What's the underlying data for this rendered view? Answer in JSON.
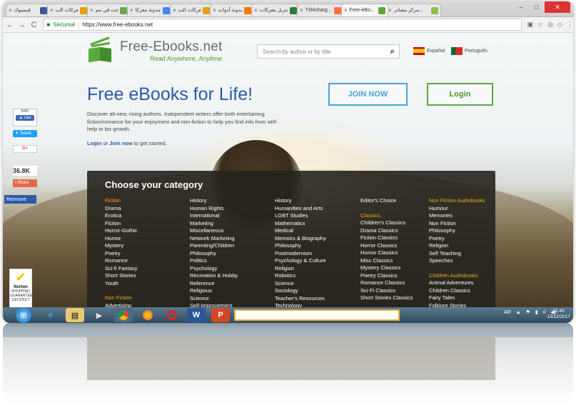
{
  "browser": {
    "tabs": [
      {
        "label": "فيسبوك",
        "color": "#3b5998"
      },
      {
        "label": "معركات الب...",
        "color": "#e5a00d"
      },
      {
        "label": "بحث في مم...",
        "color": "#6aa84f"
      },
      {
        "label": "مدونة معركا...",
        "color": "#4285f4"
      },
      {
        "label": "معركات الب...",
        "color": "#e5a00d"
      },
      {
        "label": "مدونة أدوات...",
        "color": "#f57c00"
      },
      {
        "label": "تنزيل معركات...",
        "color": "#2e7d32"
      },
      {
        "label": "Télécharg...",
        "color": "#ff7043"
      },
      {
        "label": "Free-eBo...",
        "color": "#5aa838"
      },
      {
        "label": "مركز مصادر...",
        "color": "#8bc34a"
      }
    ],
    "active_tab_index": 8,
    "secure_label": "Sécurisé",
    "url": "https://www.free-ebooks.net"
  },
  "site": {
    "logo_name": "Free-Ebooks.net",
    "logo_tagline": "Read Anywhere, Anytime.",
    "search_placeholder": "Search by author or by title",
    "lang_es": "Español",
    "lang_pt": "Português"
  },
  "hero": {
    "title": "Free eBooks for Life!",
    "description": "Discover all-new, rising authors. Independent writers offer both entertaining fiction/romance for your enjoyment and non-fiction to help you find info from self-help to biz growth.",
    "login_link": "Login",
    "or_text": " or ",
    "join_link": "Join now",
    "tail_text": " to get started.",
    "join_button": "JOIN NOW",
    "login_button": "Login"
  },
  "social": {
    "like_count": "64K",
    "like_label": "Like",
    "tweet_label": "Tweet",
    "gplus_label": "G+",
    "share_count": "36.8K",
    "share_label": "Share",
    "remove_label": "Remove"
  },
  "norton": {
    "brand": "Norton",
    "line1": "SHOPPING",
    "line2": "GUARANTEE",
    "date": "13/12/2017"
  },
  "categories": {
    "title": "Choose your category",
    "columns": [
      [
        {
          "text": "Fiction",
          "head": true
        },
        {
          "text": "Drama"
        },
        {
          "text": "Erotica"
        },
        {
          "text": "Fiction"
        },
        {
          "text": "Horror-Gothic"
        },
        {
          "text": "Humor"
        },
        {
          "text": "Mystery"
        },
        {
          "text": "Poetry"
        },
        {
          "text": "Romance"
        },
        {
          "text": "Sci-fi Fantasy"
        },
        {
          "text": "Short Stories"
        },
        {
          "text": "Youth"
        },
        {
          "text": "Non Fiction",
          "head": true,
          "gap": true
        },
        {
          "text": "Advertising"
        }
      ],
      [
        {
          "text": "History"
        },
        {
          "text": "Human Rights"
        },
        {
          "text": "International"
        },
        {
          "text": "Marketing"
        },
        {
          "text": "Miscellaneous"
        },
        {
          "text": "Network Marketing"
        },
        {
          "text": "Parenting/Children"
        },
        {
          "text": "Philosophy"
        },
        {
          "text": "Politics"
        },
        {
          "text": "Psychology"
        },
        {
          "text": "Recreation & Hobby"
        },
        {
          "text": "Reference"
        },
        {
          "text": "Religious"
        },
        {
          "text": "Science"
        },
        {
          "text": "Self-Improvement"
        }
      ],
      [
        {
          "text": "History"
        },
        {
          "text": "Humanities and Arts"
        },
        {
          "text": "LGBT Studies"
        },
        {
          "text": "Mathematics"
        },
        {
          "text": "Medical"
        },
        {
          "text": "Memoirs & Biography"
        },
        {
          "text": "Philosophy"
        },
        {
          "text": "Postmodernism"
        },
        {
          "text": "Psychology & Culture"
        },
        {
          "text": "Religion"
        },
        {
          "text": "Robotics"
        },
        {
          "text": "Science"
        },
        {
          "text": "Sociology"
        },
        {
          "text": "Teacher's Resources"
        },
        {
          "text": "Technology"
        }
      ],
      [
        {
          "text": "Editor's Choice"
        },
        {
          "text": "Classics",
          "head": true,
          "gap": true
        },
        {
          "text": "Children's Classics"
        },
        {
          "text": "Drama Classics"
        },
        {
          "text": "Fiction Classics"
        },
        {
          "text": "Horror Classics"
        },
        {
          "text": "Humor Classics"
        },
        {
          "text": "Misc Classics"
        },
        {
          "text": "Mystery Classics"
        },
        {
          "text": "Poetry Classics"
        },
        {
          "text": "Romance Classics"
        },
        {
          "text": "Sci-Fi Classics"
        },
        {
          "text": "Short Stories Classics"
        }
      ],
      [
        {
          "text": "Non Fiction Audiobooks",
          "head": true
        },
        {
          "text": "Humour"
        },
        {
          "text": "Memories"
        },
        {
          "text": "Non Fiction"
        },
        {
          "text": "Philosophy"
        },
        {
          "text": "Poetry"
        },
        {
          "text": "Religion"
        },
        {
          "text": "Self Teaching"
        },
        {
          "text": "Speeches"
        },
        {
          "text": "Children Audiobooks",
          "head": true,
          "gap": true
        },
        {
          "text": "Animal Adventures"
        },
        {
          "text": "Children Classics"
        },
        {
          "text": "Fairy Tales"
        },
        {
          "text": "Folklore Stories"
        }
      ]
    ]
  },
  "taskbar": {
    "lang": "AR",
    "time": "11:45",
    "date": "13/12/2017"
  },
  "colors": {
    "brand_green": "#5aa838",
    "brand_blue": "#2b5aa5",
    "join_blue": "#4aa1d7",
    "category_orange": "#f0a623"
  }
}
